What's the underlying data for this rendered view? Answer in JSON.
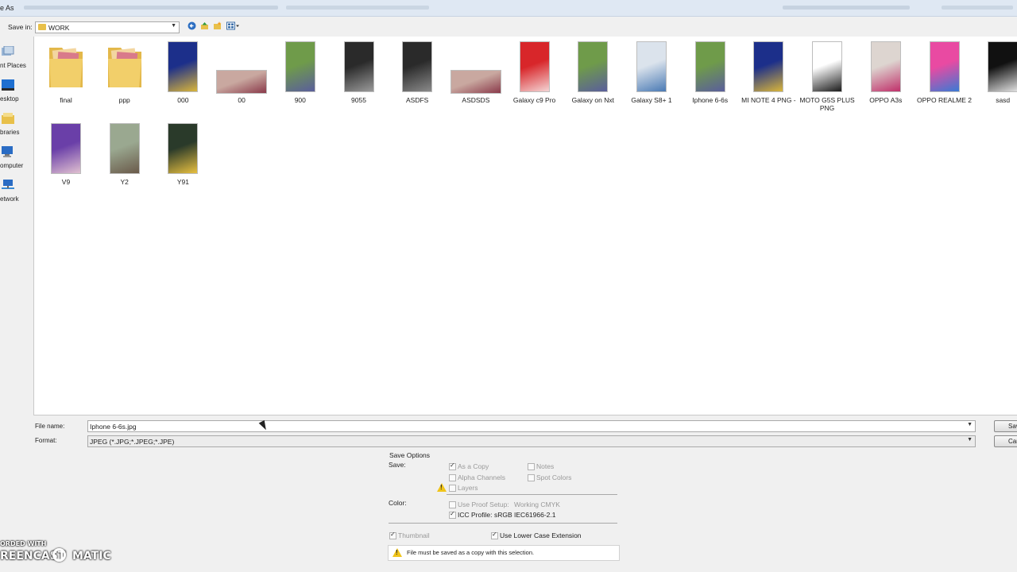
{
  "window": {
    "title": "e As"
  },
  "toolbar": {
    "save_in_label": "Save in:",
    "folder": "WORK"
  },
  "places": [
    {
      "label": "nt Places",
      "icon": "recent-places-icon"
    },
    {
      "label": "esktop",
      "icon": "desktop-icon"
    },
    {
      "label": "braries",
      "icon": "libraries-icon"
    },
    {
      "label": "omputer",
      "icon": "computer-icon"
    },
    {
      "label": "etwork",
      "icon": "network-icon"
    }
  ],
  "files": [
    {
      "name": "final",
      "kind": "folder"
    },
    {
      "name": "ppp",
      "kind": "folder"
    },
    {
      "name": "000",
      "kind": "tall",
      "colors": [
        "#1c2f8a",
        "#d9b53a"
      ]
    },
    {
      "name": "00",
      "kind": "wide",
      "colors": [
        "#c9a8a0",
        "#8a3a4a"
      ]
    },
    {
      "name": "900",
      "kind": "tall",
      "colors": [
        "#6f9b4a",
        "#5a5e9c"
      ]
    },
    {
      "name": "9055",
      "kind": "tall",
      "colors": [
        "#2a2a2a",
        "#9a9a9a"
      ]
    },
    {
      "name": "ASDFS",
      "kind": "tall",
      "colors": [
        "#2a2a2a",
        "#8a8a8a"
      ]
    },
    {
      "name": "ASDSDS",
      "kind": "wide",
      "colors": [
        "#c9a8a0",
        "#8a3a4a"
      ]
    },
    {
      "name": "Galaxy c9 Pro",
      "kind": "tall",
      "colors": [
        "#d8262a",
        "#f4d4d4"
      ]
    },
    {
      "name": "Galaxy on Nxt",
      "kind": "tall",
      "colors": [
        "#6f9b4a",
        "#5a5e9c"
      ]
    },
    {
      "name": "Galaxy S8+ 1",
      "kind": "tall",
      "colors": [
        "#dbe3ec",
        "#4a7ab4"
      ]
    },
    {
      "name": "Iphone 6-6s",
      "kind": "tall",
      "colors": [
        "#6f9b4a",
        "#5a5e9c"
      ]
    },
    {
      "name": "MI NOTE 4 PNG -",
      "kind": "tall",
      "colors": [
        "#1c2f8a",
        "#d9b53a"
      ]
    },
    {
      "name": "MOTO G5S PLUS PNG",
      "kind": "tall",
      "colors": [
        "#ffffff",
        "#1a1a1a"
      ]
    },
    {
      "name": "OPPO A3s",
      "kind": "tall",
      "colors": [
        "#ddd5d0",
        "#c0306a"
      ]
    },
    {
      "name": "OPPO REALME 2",
      "kind": "tall",
      "colors": [
        "#e94aa2",
        "#3a7ad4"
      ]
    },
    {
      "name": "sasd",
      "kind": "tall",
      "colors": [
        "#111111",
        "#e0e0e0"
      ]
    },
    {
      "name": "V9",
      "kind": "tall",
      "colors": [
        "#6a3fa8",
        "#e0c0d0"
      ]
    },
    {
      "name": "Y2",
      "kind": "tall",
      "colors": [
        "#9aa890",
        "#6a5a4a"
      ]
    },
    {
      "name": "Y91",
      "kind": "tall",
      "colors": [
        "#2a3a2a",
        "#e8c040"
      ]
    }
  ],
  "form": {
    "file_name_label": "File name:",
    "file_name_value": "Iphone 6-6s.jpg",
    "format_label": "Format:",
    "format_value": "JPEG (*.JPG;*.JPEG;*.JPE)",
    "save_button": "Sav",
    "cancel_button": "Canc"
  },
  "save_options": {
    "title": "Save Options",
    "save_label": "Save:",
    "as_copy": "As a Copy",
    "notes": "Notes",
    "alpha_channels": "Alpha Channels",
    "spot_colors": "Spot Colors",
    "layers": "Layers",
    "color_label": "Color:",
    "use_proof_setup": "Use Proof Setup:",
    "proof_value": "Working CMYK",
    "icc_profile": "ICC Profile:",
    "icc_value": "sRGB IEC61966-2.1",
    "thumbnail": "Thumbnail",
    "lower_case_ext": "Use Lower Case Extension",
    "warning": "File must be saved as a copy with this selection."
  },
  "watermark": {
    "line1": "ORDED WITH",
    "line2a": "REENCAST",
    "line2b": "MATIC"
  }
}
